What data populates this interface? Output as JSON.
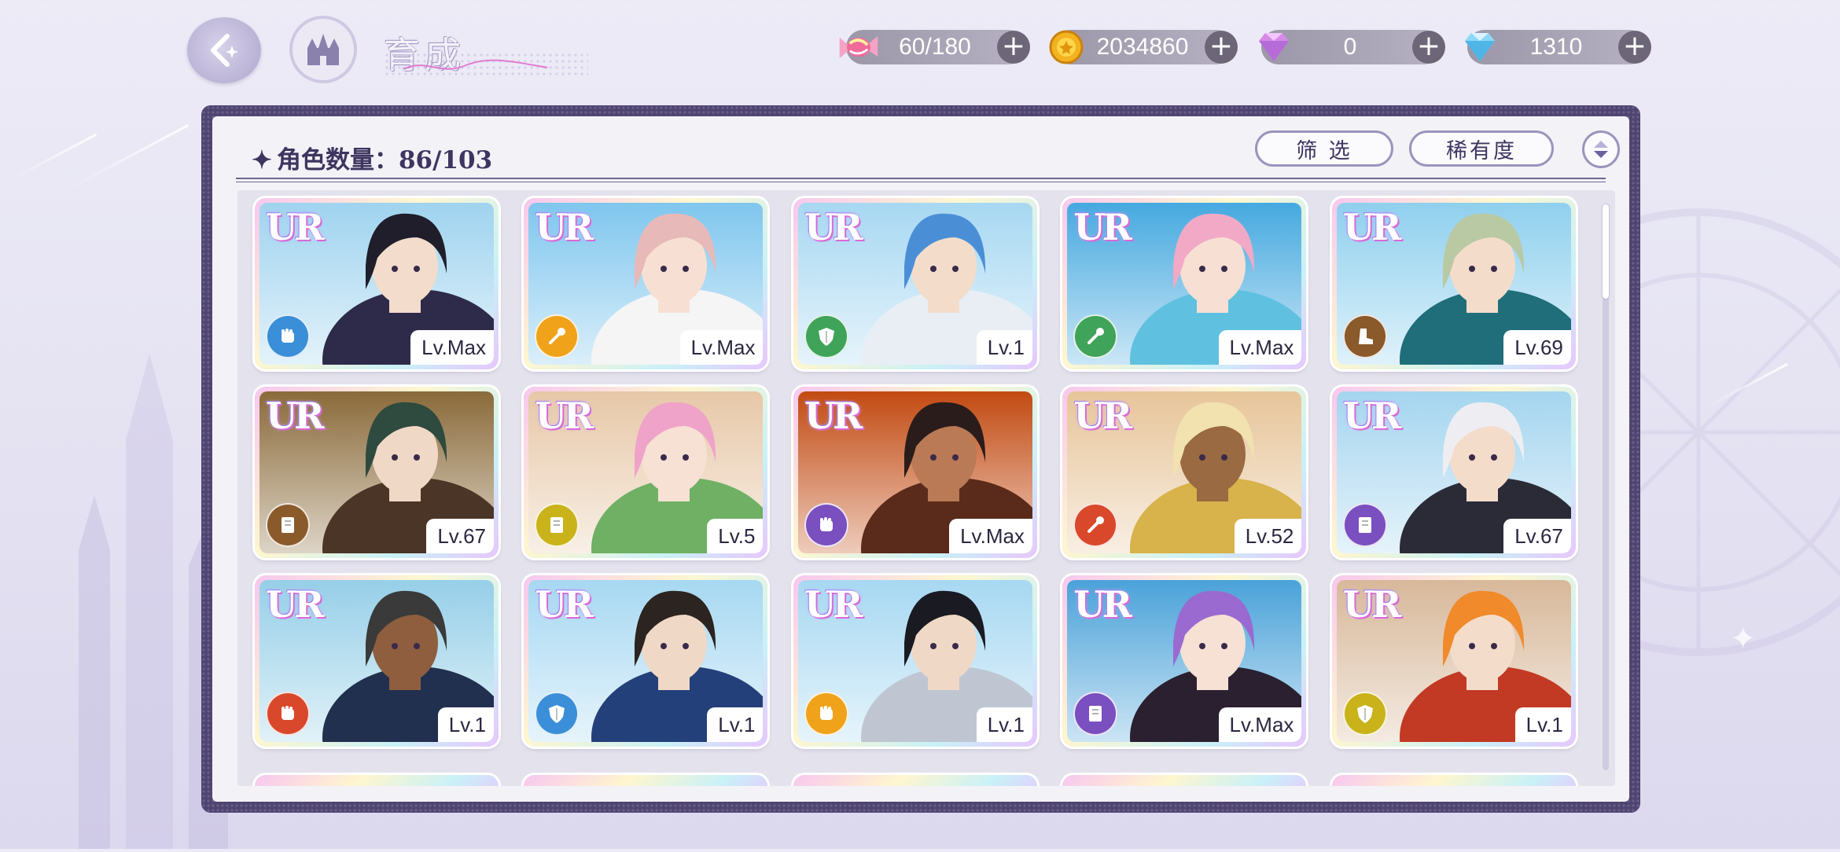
{
  "header": {
    "title": "育成"
  },
  "resources": [
    {
      "name": "stamina",
      "icon": "candy-icon",
      "value": "60/180"
    },
    {
      "name": "gold",
      "icon": "coin-icon",
      "value": "2034860"
    },
    {
      "name": "paid_gems",
      "icon": "pink-diamond-icon",
      "value": "0"
    },
    {
      "name": "free_gems",
      "icon": "blue-diamond-icon",
      "value": "1310"
    }
  ],
  "panel": {
    "count_label": "角色数量：86/103",
    "filter_label": "筛 选",
    "rarity_label": "稀有度"
  },
  "cards": [
    {
      "rarity": "UR",
      "level": "Lv.Max",
      "attr_color": "#3a8fd8",
      "attr_icon": "fist-icon",
      "hair": "#1f1e2a",
      "skin": "#f3dccb",
      "outfit": "#2e2a4a",
      "bg": "#9fd3ef"
    },
    {
      "rarity": "UR",
      "level": "Lv.Max",
      "attr_color": "#f0a21a",
      "attr_icon": "wand-icon",
      "hair": "#e8b9b9",
      "skin": "#f7e0d3",
      "outfit": "#f5f5f5",
      "bg": "#7fc6ee"
    },
    {
      "rarity": "UR",
      "level": "Lv.1",
      "attr_color": "#3fa35a",
      "attr_icon": "shield-icon",
      "hair": "#4a8fd6",
      "skin": "#f4dccb",
      "outfit": "#e9eef5",
      "bg": "#a7d8f2"
    },
    {
      "rarity": "UR",
      "level": "Lv.Max",
      "attr_color": "#3fa35a",
      "attr_icon": "wand-icon",
      "hair": "#f2a9c6",
      "skin": "#f7e0d3",
      "outfit": "#5fc1df",
      "bg": "#45a9df"
    },
    {
      "rarity": "UR",
      "level": "Lv.69",
      "attr_color": "#8a5a2b",
      "attr_icon": "boot-icon",
      "hair": "#b9c9a3",
      "skin": "#f4dccb",
      "outfit": "#1f6e7a",
      "bg": "#8fd0ee"
    },
    {
      "rarity": "UR",
      "level": "Lv.67",
      "attr_color": "#8a5a2b",
      "attr_icon": "book-icon",
      "hair": "#2f4a3f",
      "skin": "#f0d8c6",
      "outfit": "#4a3526",
      "bg": "#8a6a3a"
    },
    {
      "rarity": "UR",
      "level": "Lv.5",
      "attr_color": "#c9b21a",
      "attr_icon": "book-icon",
      "hair": "#f0a3c9",
      "skin": "#f6e1d4",
      "outfit": "#6fb064",
      "bg": "#e7c8a8"
    },
    {
      "rarity": "UR",
      "level": "Lv.Max",
      "attr_color": "#7a4fbf",
      "attr_icon": "fist-icon",
      "hair": "#2a1c1a",
      "skin": "#b97a55",
      "outfit": "#5a2a1a",
      "bg": "#c24a12"
    },
    {
      "rarity": "UR",
      "level": "Lv.52",
      "attr_color": "#d9482a",
      "attr_icon": "wand-icon",
      "hair": "#f1e2b0",
      "skin": "#9a6a42",
      "outfit": "#d8b24a",
      "bg": "#e7c59a"
    },
    {
      "rarity": "UR",
      "level": "Lv.67",
      "attr_color": "#7a4fbf",
      "attr_icon": "book-icon",
      "hair": "#eeeef2",
      "skin": "#f4dccb",
      "outfit": "#2b2b38",
      "bg": "#a5d5ef"
    },
    {
      "rarity": "UR",
      "level": "Lv.1",
      "attr_color": "#d9482a",
      "attr_icon": "fist-icon",
      "hair": "#3a3a3a",
      "skin": "#8e5e3e",
      "outfit": "#22304f",
      "bg": "#96cfe8"
    },
    {
      "rarity": "UR",
      "level": "Lv.1",
      "attr_color": "#3a8fd8",
      "attr_icon": "shield-icon",
      "hair": "#2b2420",
      "skin": "#f0d8c6",
      "outfit": "#24407a",
      "bg": "#a7d8f2"
    },
    {
      "rarity": "UR",
      "level": "Lv.1",
      "attr_color": "#f0a21a",
      "attr_icon": "fist-icon",
      "hair": "#1a1a22",
      "skin": "#f0d8c6",
      "outfit": "#bfc6d2",
      "bg": "#a7d8f2"
    },
    {
      "rarity": "UR",
      "level": "Lv.Max",
      "attr_color": "#7a4fbf",
      "attr_icon": "book-icon",
      "hair": "#9a6ad0",
      "skin": "#f6e1d4",
      "outfit": "#2a2030",
      "bg": "#4aa2d9"
    },
    {
      "rarity": "UR",
      "level": "Lv.1",
      "attr_color": "#c9b21a",
      "attr_icon": "shield-icon",
      "hair": "#f08a2a",
      "skin": "#f4dccb",
      "outfit": "#c23a24",
      "bg": "#d8b89a"
    }
  ]
}
